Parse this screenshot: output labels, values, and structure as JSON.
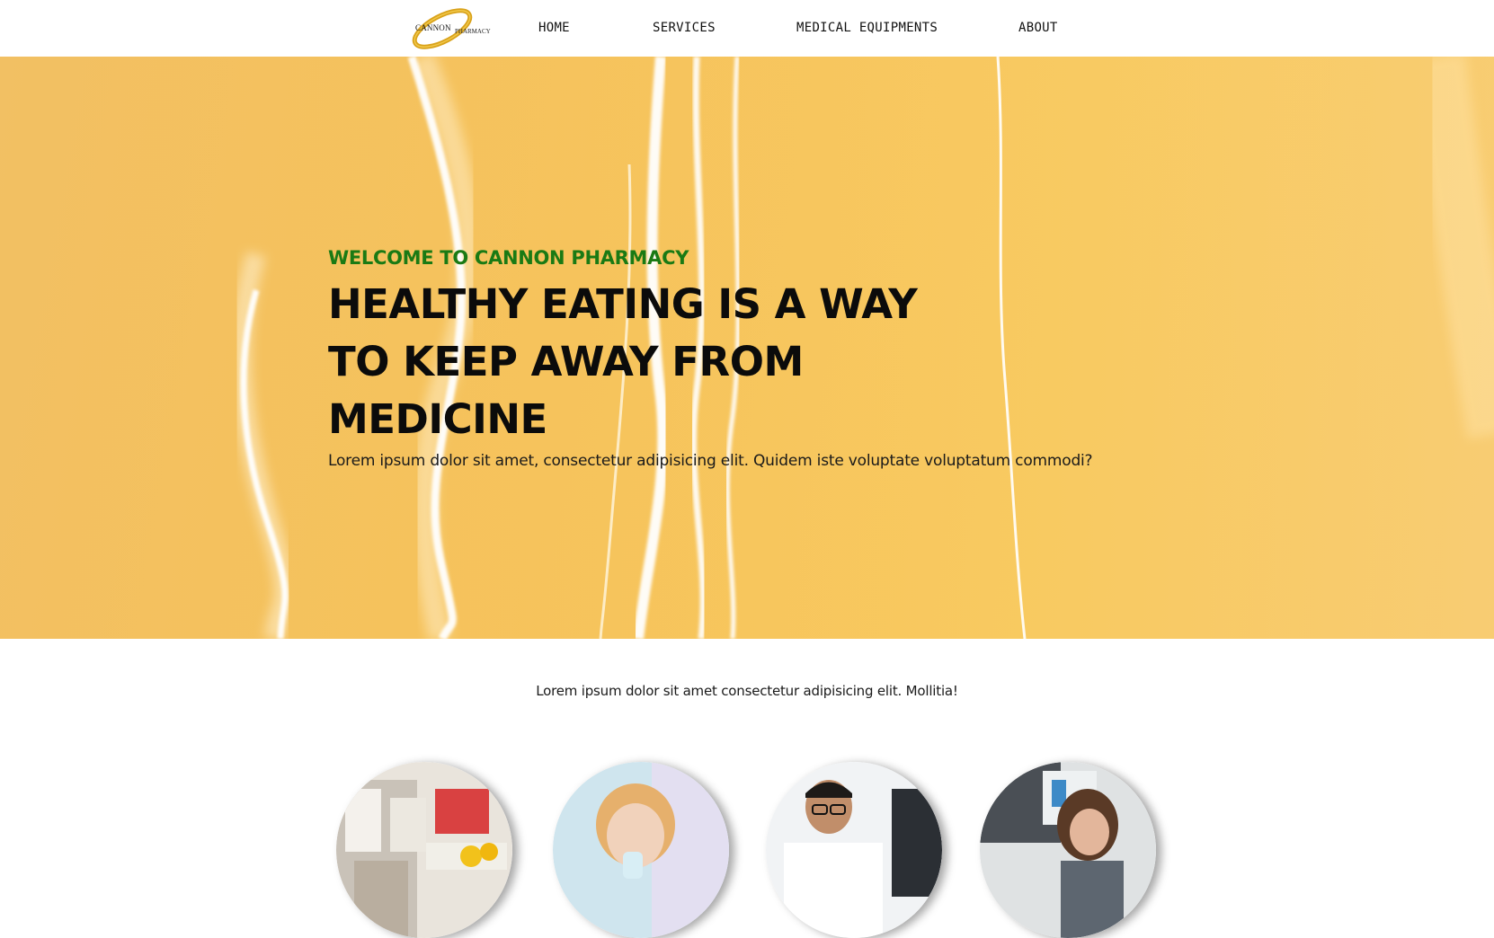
{
  "brand": {
    "logo_word_1": "CANNON",
    "logo_word_2": "PHARMACY",
    "logo_color": "#d9a21a"
  },
  "nav": {
    "items": [
      {
        "label": "HOME"
      },
      {
        "label": "SERVICES"
      },
      {
        "label": "MEDICAL EQUIPMENTS"
      },
      {
        "label": "ABOUT"
      }
    ]
  },
  "hero": {
    "eyebrow": "WELCOME TO CANNON PHARMACY",
    "title": "HEALTHY EATING IS A WAY TO KEEP AWAY FROM MEDICINE",
    "subtitle": "Lorem ipsum dolor sit amet, consectetur adipisicing elit. Quidem iste voluptate voluptatum commodi?",
    "background_color": "#f6c258",
    "eyebrow_color": "#1a7a14"
  },
  "intro": {
    "text": "Lorem ipsum dolor sit amet consectetur adipisicing elit. Mollitia!"
  },
  "team": {
    "photos": [
      {
        "subject": "pharmacy-shelves-photo"
      },
      {
        "subject": "patient-with-inhaler-photo"
      },
      {
        "subject": "doctor-with-glasses-photo"
      },
      {
        "subject": "pharmacist-woman-photo"
      }
    ]
  }
}
